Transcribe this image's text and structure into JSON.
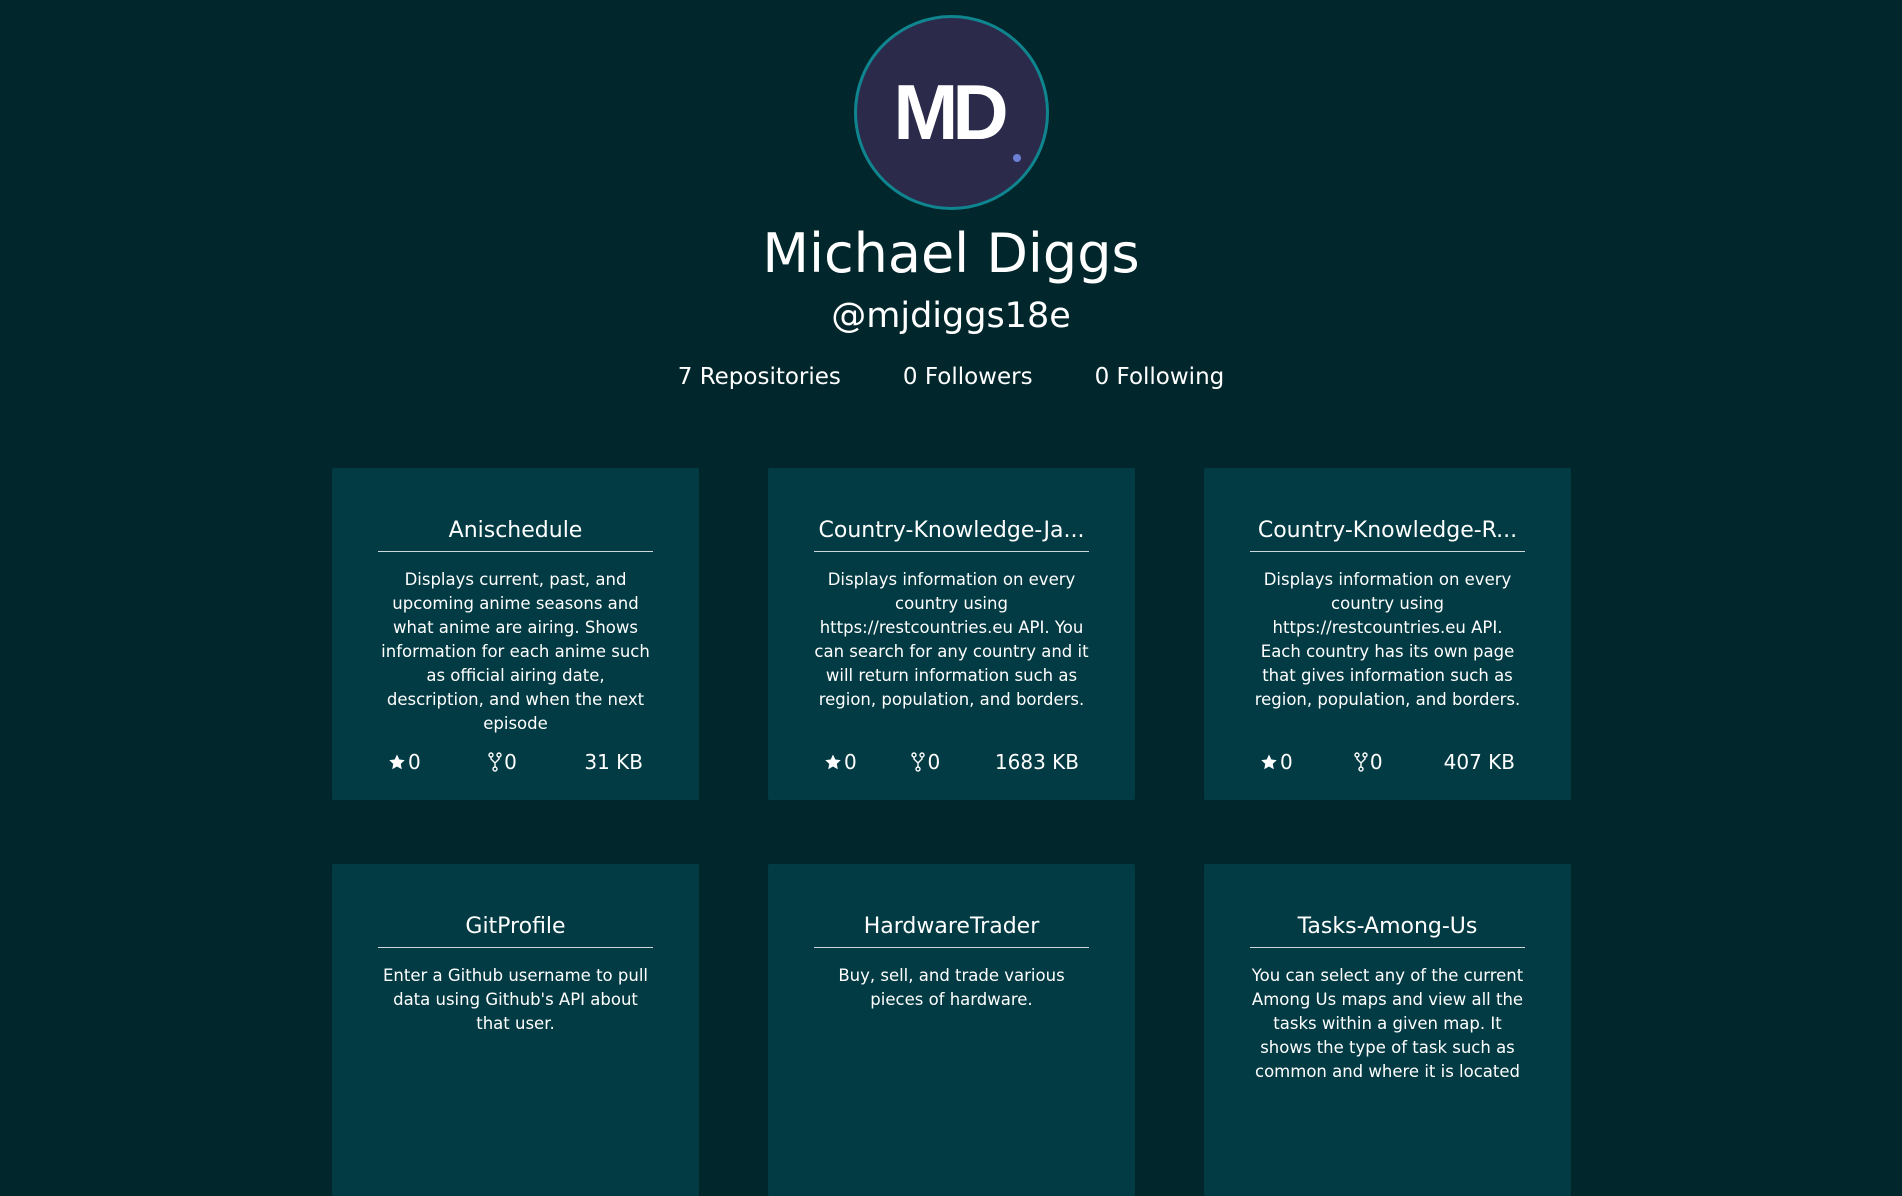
{
  "profile": {
    "avatar_initials": "MD",
    "name": "Michael Diggs",
    "handle": "@mjdiggs18e"
  },
  "stats": {
    "repositories": "7 Repositories",
    "followers": "0 Followers",
    "following": "0 Following"
  },
  "repos": [
    {
      "title": "Anischedule",
      "description": "Displays current, past, and upcoming anime seasons and what anime are airing. Shows information for each anime such as official airing date, description, and when the next episode",
      "stars": "0",
      "forks": "0",
      "size": "31 KB"
    },
    {
      "title": "Country-Knowledge-Ja...",
      "description": "Displays information on every country using https://restcountries.eu API. You can search for any country and it will return information such as region, population, and borders.",
      "stars": "0",
      "forks": "0",
      "size": "1683 KB"
    },
    {
      "title": "Country-Knowledge-R...",
      "description": "Displays information on every country using https://restcountries.eu API. Each country has its own page that gives information such as region, population, and borders.",
      "stars": "0",
      "forks": "0",
      "size": "407 KB"
    },
    {
      "title": "GitProfile",
      "description": "Enter a Github username to pull data using Github's API about that user."
    },
    {
      "title": "HardwareTrader",
      "description": "Buy, sell, and trade various pieces of hardware."
    },
    {
      "title": "Tasks-Among-Us",
      "description": "You can select any of the current Among Us maps and view all the tasks within a given map. It shows the type of task such as common and where it is located"
    }
  ],
  "colors": {
    "background": "#01272c",
    "card": "#023b43",
    "avatar_ring": "#0f868f",
    "avatar_fill": "#2c2a4a"
  },
  "icons": {
    "star": "star-icon",
    "fork": "fork-icon"
  }
}
